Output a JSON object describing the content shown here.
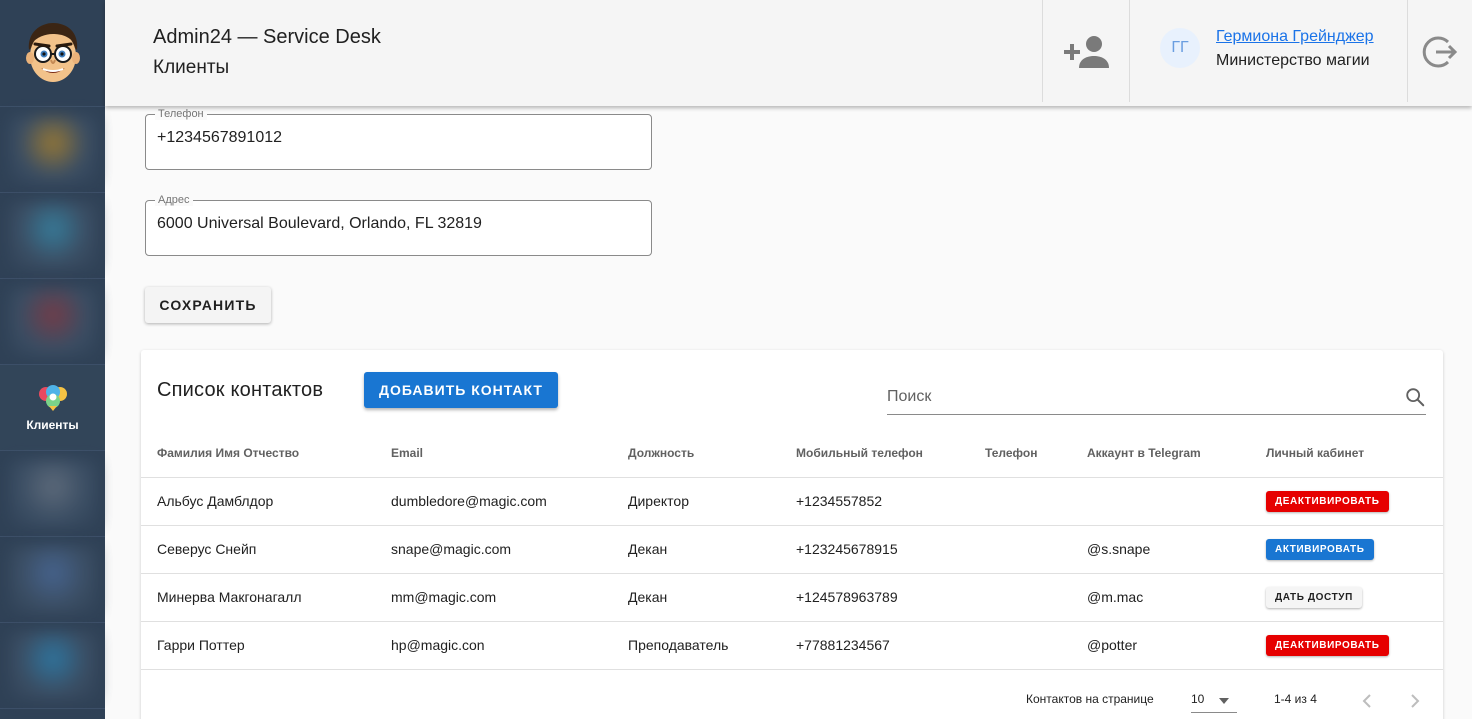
{
  "header": {
    "app_title": "Admin24 — Service Desk",
    "page_title": "Клиенты",
    "user": {
      "initials": "ГГ",
      "name": "Гермиона Грейнджер",
      "organization": "Министерство магии"
    },
    "icons": {
      "add_user": "person-add-icon",
      "logout": "logout-icon"
    }
  },
  "sidebar": {
    "active_label": "Клиенты",
    "items": [
      {
        "icon": "blurred-icon",
        "color": "#b88a2c"
      },
      {
        "icon": "blurred-icon",
        "color": "#3a8fb0"
      },
      {
        "icon": "blurred-icon",
        "color": "#8a3b44"
      },
      {
        "icon": "clients-icon",
        "label": "Клиенты",
        "active": true
      },
      {
        "icon": "blurred-icon",
        "color": "#57677a"
      },
      {
        "icon": "blurred-icon",
        "color": "#4e6fa0"
      },
      {
        "icon": "blurred-icon",
        "color": "#2f86b6"
      }
    ]
  },
  "form": {
    "phone": {
      "label": "Телефон",
      "value": "+1234567891012"
    },
    "address": {
      "label": "Адрес",
      "value": "6000 Universal Boulevard, Orlando, FL 32819"
    },
    "save_label": "СОХРАНИТЬ"
  },
  "contacts": {
    "title": "Список контактов",
    "add_label": "ДОБАВИТЬ КОНТАКТ",
    "search_placeholder": "Поиск",
    "columns": [
      "Фамилия Имя Отчество",
      "Email",
      "Должность",
      "Мобильный телефон",
      "Телефон",
      "Аккаунт в Telegram",
      "Личный кабинет"
    ],
    "rows": [
      {
        "name": "Альбус Дамблдор",
        "email": "dumbledore@magic.com",
        "position": "Директор",
        "mobile": "+1234557852",
        "phone": "",
        "telegram": "",
        "cabinet": "ДЕАКТИВИРОВАТЬ",
        "cabinet_style": "red"
      },
      {
        "name": "Северус Снейп",
        "email": "snape@magic.com",
        "position": "Декан",
        "mobile": "+123245678915",
        "phone": "",
        "telegram": "@s.snape",
        "cabinet": "АКТИВИРОВАТЬ",
        "cabinet_style": "blue"
      },
      {
        "name": "Минерва Макгонагалл",
        "email": "mm@magic.com",
        "position": "Декан",
        "mobile": "+124578963789",
        "phone": "",
        "telegram": "@m.mac",
        "cabinet": "ДАТЬ ДОСТУП",
        "cabinet_style": "gray"
      },
      {
        "name": "Гарри Поттер",
        "email": "hp@magic.con",
        "position": "Преподаватель",
        "mobile": "+77881234567",
        "phone": "",
        "telegram": "@potter",
        "cabinet": "ДЕАКТИВИРОВАТЬ",
        "cabinet_style": "red"
      }
    ],
    "pagination": {
      "rows_per_page_label": "Контактов на странице",
      "rows_per_page": "10",
      "range": "1-4 из 4"
    }
  },
  "colors": {
    "sidebar": "#2f4156",
    "primary": "#1976d2",
    "danger": "#e60000"
  }
}
